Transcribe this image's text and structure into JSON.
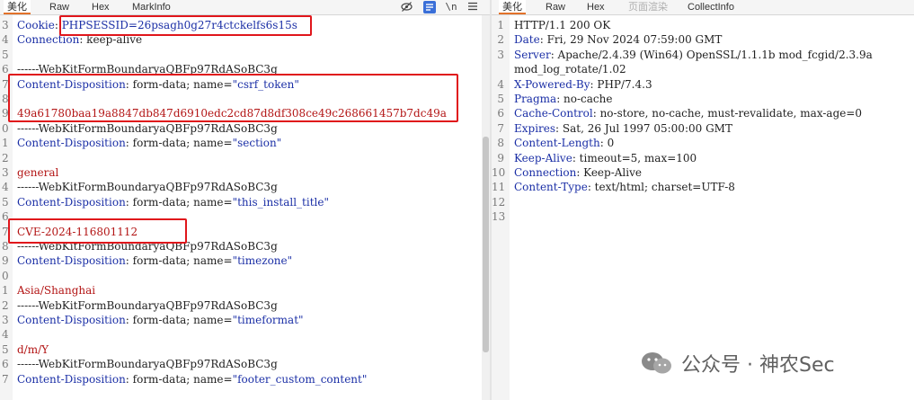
{
  "request_tabs": [
    {
      "label": "美化",
      "active": true
    },
    {
      "label": "Raw"
    },
    {
      "label": "Hex"
    },
    {
      "label": "MarkInfo"
    }
  ],
  "request_toolbar": {
    "eye_icon": "eye-slash-icon",
    "lines_icon": "line-list-icon",
    "newline_label": "\\n",
    "menu_icon": "hamburger-menu-icon"
  },
  "response_tabs": [
    {
      "label": "美化",
      "active": true
    },
    {
      "label": "Raw"
    },
    {
      "label": "Hex"
    },
    {
      "label": "页面渲染",
      "disabled": true
    },
    {
      "label": "CollectInfo"
    }
  ],
  "request_lines": [
    {
      "n": "3",
      "k": "Cookie",
      "sep": ": ",
      "v": "PHPSESSID=26psagh0g27r4ctckelfs6s15s",
      "vc": "str"
    },
    {
      "n": "4",
      "k": "Connection",
      "sep": ": ",
      "v": "keep-alive",
      "vc": "val"
    },
    {
      "n": "5",
      "k": "",
      "sep": "",
      "v": "",
      "vc": "val"
    },
    {
      "n": "6",
      "k": "",
      "sep": "",
      "v": "------WebKitFormBoundaryaQBFp97RdASoBC3g",
      "vc": "val"
    },
    {
      "n": "7",
      "k": "Content-Disposition",
      "sep": ": ",
      "v": "form-data; name=\"csrf_token\"",
      "vc": "mix"
    },
    {
      "n": "8",
      "k": "",
      "sep": "",
      "v": "",
      "vc": "val"
    },
    {
      "n": "9",
      "k": "",
      "sep": "",
      "v": "49a61780baa19a8847db847d6910edc2cd87d8df308ce49c268661457b7dc49a",
      "vc": "red"
    },
    {
      "n": "0",
      "k": "",
      "sep": "",
      "v": "------WebKitFormBoundaryaQBFp97RdASoBC3g",
      "vc": "val"
    },
    {
      "n": "1",
      "k": "Content-Disposition",
      "sep": ": ",
      "v": "form-data; name=\"section\"",
      "vc": "mix"
    },
    {
      "n": "2",
      "k": "",
      "sep": "",
      "v": "",
      "vc": "val"
    },
    {
      "n": "3",
      "k": "",
      "sep": "",
      "v": "general",
      "vc": "red"
    },
    {
      "n": "4",
      "k": "",
      "sep": "",
      "v": "------WebKitFormBoundaryaQBFp97RdASoBC3g",
      "vc": "val"
    },
    {
      "n": "5",
      "k": "Content-Disposition",
      "sep": ": ",
      "v": "form-data; name=\"this_install_title\"",
      "vc": "mix"
    },
    {
      "n": "6",
      "k": "",
      "sep": "",
      "v": "",
      "vc": "val"
    },
    {
      "n": "7",
      "k": "",
      "sep": "",
      "v": "CVE-2024-116801112",
      "vc": "red"
    },
    {
      "n": "8",
      "k": "",
      "sep": "",
      "v": "------WebKitFormBoundaryaQBFp97RdASoBC3g",
      "vc": "val"
    },
    {
      "n": "9",
      "k": "Content-Disposition",
      "sep": ": ",
      "v": "form-data; name=\"timezone\"",
      "vc": "mix"
    },
    {
      "n": "0",
      "k": "",
      "sep": "",
      "v": "",
      "vc": "val"
    },
    {
      "n": "1",
      "k": "",
      "sep": "",
      "v": "Asia/Shanghai",
      "vc": "red"
    },
    {
      "n": "2",
      "k": "",
      "sep": "",
      "v": "------WebKitFormBoundaryaQBFp97RdASoBC3g",
      "vc": "val"
    },
    {
      "n": "3",
      "k": "Content-Disposition",
      "sep": ": ",
      "v": "form-data; name=\"timeformat\"",
      "vc": "mix"
    },
    {
      "n": "4",
      "k": "",
      "sep": "",
      "v": "",
      "vc": "val"
    },
    {
      "n": "5",
      "k": "",
      "sep": "",
      "v": "d/m/Y",
      "vc": "red"
    },
    {
      "n": "6",
      "k": "",
      "sep": "",
      "v": "------WebKitFormBoundaryaQBFp97RdASoBC3g",
      "vc": "val"
    },
    {
      "n": "7",
      "k": "Content-Disposition",
      "sep": ": ",
      "v": "form-data; name=\"footer_custom_content\"",
      "vc": "mix"
    }
  ],
  "response_lines": [
    {
      "n": "1",
      "k": "",
      "sep": "",
      "v": "HTTP/1.1 200 OK",
      "vc": "val"
    },
    {
      "n": "2",
      "k": "Date",
      "sep": ": ",
      "v": "Fri, 29 Nov 2024 07:59:00 GMT",
      "vc": "val"
    },
    {
      "n": "3",
      "k": "Server",
      "sep": ": ",
      "v": "Apache/2.4.39 (Win64) OpenSSL/1.1.1b mod_fcgid/2.3.9a",
      "vc": "val"
    },
    {
      "n": "",
      "k": "",
      "sep": "",
      "v": "mod_log_rotate/1.02",
      "vc": "val"
    },
    {
      "n": "4",
      "k": "X-Powered-By",
      "sep": ": ",
      "v": "PHP/7.4.3",
      "vc": "val"
    },
    {
      "n": "5",
      "k": "Pragma",
      "sep": ": ",
      "v": "no-cache",
      "vc": "val"
    },
    {
      "n": "6",
      "k": "Cache-Control",
      "sep": ": ",
      "v": "no-store, no-cache, must-revalidate, max-age=0",
      "vc": "val"
    },
    {
      "n": "7",
      "k": "Expires",
      "sep": ": ",
      "v": "Sat, 26 Jul 1997 05:00:00 GMT",
      "vc": "val"
    },
    {
      "n": "8",
      "k": "Content-Length",
      "sep": ": ",
      "v": "0",
      "vc": "val"
    },
    {
      "n": "9",
      "k": "Keep-Alive",
      "sep": ": ",
      "v": "timeout=5, max=100",
      "vc": "val"
    },
    {
      "n": "10",
      "k": "Connection",
      "sep": ": ",
      "v": "Keep-Alive",
      "vc": "val"
    },
    {
      "n": "11",
      "k": "Content-Type",
      "sep": ": ",
      "v": "text/html; charset=UTF-8",
      "vc": "val"
    },
    {
      "n": "12",
      "k": "",
      "sep": "",
      "v": "",
      "vc": "val"
    },
    {
      "n": "13",
      "k": "",
      "sep": "",
      "v": "",
      "vc": "val"
    }
  ],
  "watermark": {
    "text": "公众号 · 神农Sec",
    "icon": "wechat-icon"
  },
  "colors": {
    "accent_tab": "#e2722a",
    "highlight_box": "#e0161b",
    "header_key": "#1b2fa6",
    "body_value": "#b31515"
  }
}
